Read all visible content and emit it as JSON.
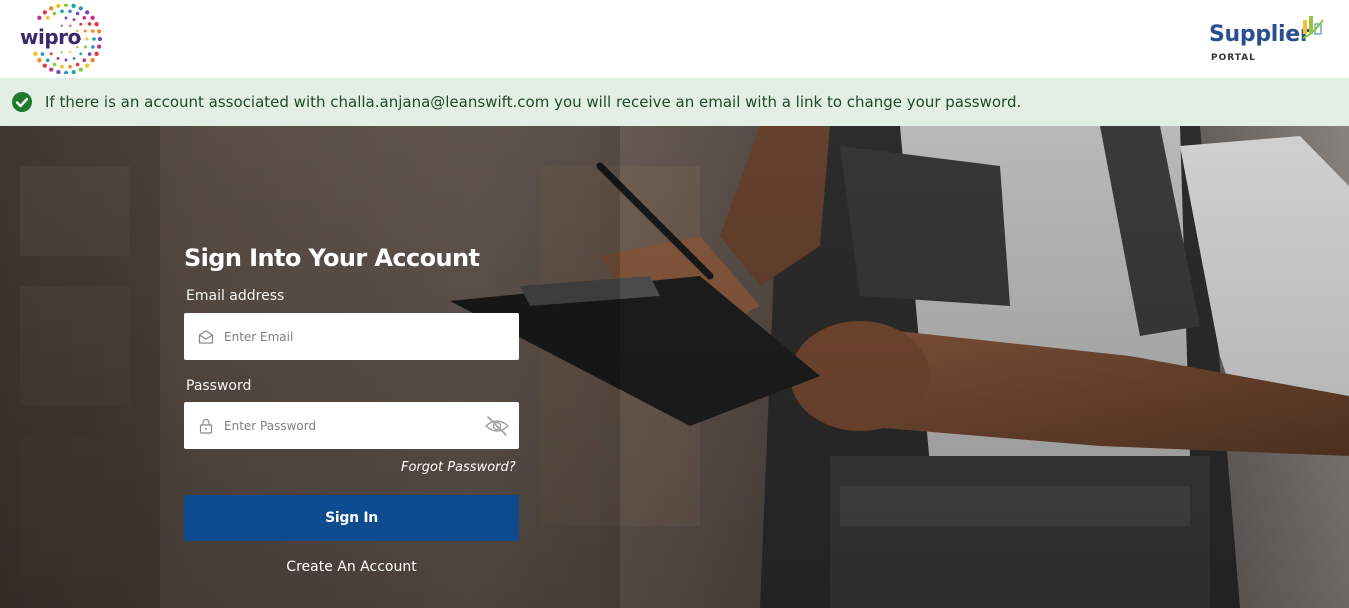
{
  "header": {
    "left_logo_text": "wipro",
    "right_logo_word": "Supplier",
    "right_logo_sub": "PORTAL"
  },
  "alert": {
    "message": "If there is an account associated with challa.anjana@leanswift.com you will receive an email with a link to change your password.",
    "icon": "check-circle-icon",
    "color": "#1f7a2e"
  },
  "signin": {
    "title": "Sign Into Your Account",
    "email_label": "Email address",
    "email_placeholder": "Enter Email",
    "email_value": "",
    "password_label": "Password",
    "password_placeholder": "Enter Password",
    "password_value": "",
    "forgot_label": "Forgot Password?",
    "submit_label": "Sign In",
    "create_label": "Create An Account"
  },
  "colors": {
    "primary_button": "#0e4b8f",
    "alert_bg": "#e3efe4"
  }
}
